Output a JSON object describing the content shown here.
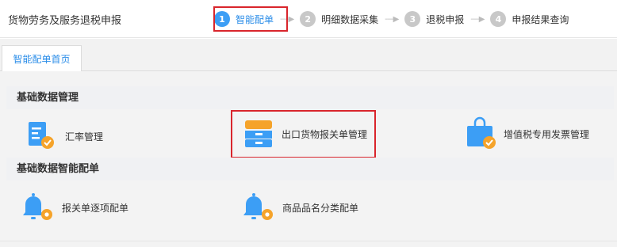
{
  "app": {
    "title": "货物劳务及服务退税申报"
  },
  "steps": [
    {
      "num": "1",
      "label": "智能配单",
      "active": true
    },
    {
      "num": "2",
      "label": "明细数据采集",
      "active": false
    },
    {
      "num": "3",
      "label": "退税申报",
      "active": false
    },
    {
      "num": "4",
      "label": "申报结果查询",
      "active": false
    }
  ],
  "tabs": [
    {
      "label": "智能配单首页"
    }
  ],
  "sections": [
    {
      "title": "基础数据管理",
      "items": [
        {
          "label": "汇率管理",
          "icon": "exchange-rate-doc-icon"
        },
        {
          "label": "出口货物报关单管理",
          "icon": "customs-declaration-box-icon"
        },
        {
          "label": "增值税专用发票管理",
          "icon": "vat-invoice-bag-icon"
        }
      ]
    },
    {
      "title": "基础数据智能配单",
      "items": [
        {
          "label": "报关单逐项配单",
          "icon": "bell-gear-icon"
        },
        {
          "label": "商品品名分类配单",
          "icon": "bell-gear-icon"
        }
      ]
    }
  ],
  "colors": {
    "accent": "#3c9ef5",
    "highlight": "#d9252c",
    "icon_orange": "#f5a32a"
  }
}
